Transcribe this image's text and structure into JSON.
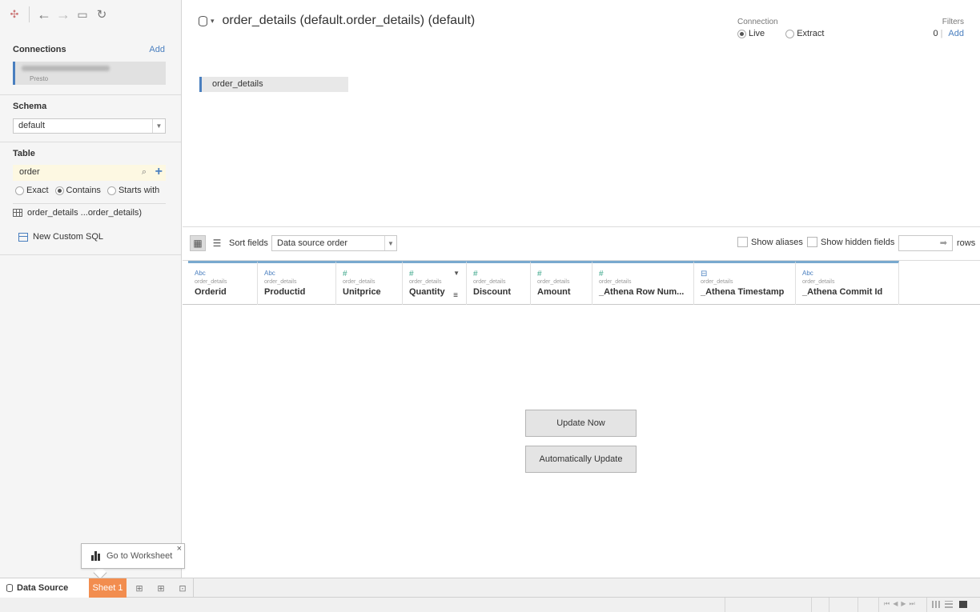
{
  "toolbar": {
    "icons": [
      "tableau-logo-icon",
      "back-arrow-icon",
      "forward-arrow-icon",
      "save-icon",
      "refresh-icon"
    ]
  },
  "sidebar": {
    "connections_label": "Connections",
    "add_label": "Add",
    "connection_type": "Presto",
    "schema_label": "Schema",
    "schema_value": "default",
    "table_label": "Table",
    "search_value": "order",
    "match_options": [
      {
        "label": "Exact",
        "selected": false
      },
      {
        "label": "Contains",
        "selected": true
      },
      {
        "label": "Starts with",
        "selected": false
      }
    ],
    "table_item": "order_details ...order_details)",
    "custom_sql": "New Custom SQL"
  },
  "canvas": {
    "title": "order_details (default.order_details) (default)",
    "connection_label": "Connection",
    "connection_live": "Live",
    "connection_extract": "Extract",
    "connection_selected": "Live",
    "filters_label": "Filters",
    "filters_count": "0",
    "filters_add": "Add",
    "table_pill": "order_details"
  },
  "grid_toolbar": {
    "sort_label": "Sort fields",
    "sort_value": "Data source order",
    "show_aliases": "Show aliases",
    "show_hidden": "Show hidden fields",
    "rows_label": "rows"
  },
  "columns": [
    {
      "type": "Abc",
      "source": "order_details",
      "name": "Orderid"
    },
    {
      "type": "Abc",
      "source": "order_details",
      "name": "Productid"
    },
    {
      "type": "#",
      "source": "order_details",
      "name": "Unitprice"
    },
    {
      "type": "#",
      "source": "order_details",
      "name": "Quantity"
    },
    {
      "type": "#",
      "source": "order_details",
      "name": "Discount"
    },
    {
      "type": "#",
      "source": "order_details",
      "name": "Amount"
    },
    {
      "type": "#",
      "source": "order_details",
      "name": "_Athena Row Num..."
    },
    {
      "type": "date-time",
      "source": "order_details",
      "name": "_Athena Timestamp"
    },
    {
      "type": "Abc",
      "source": "order_details",
      "name": "_Athena Commit Id"
    }
  ],
  "buttons": {
    "update_now": "Update Now",
    "auto_update": "Automatically Update"
  },
  "tooltip": {
    "text": "Go to Worksheet",
    "close": "×"
  },
  "tabs": {
    "data_source": "Data Source",
    "sheet1": "Sheet 1"
  },
  "colors": {
    "accent": "#4a7fbf",
    "sheet_tab": "#f28d4f",
    "column_bar": "#79a9cf"
  }
}
